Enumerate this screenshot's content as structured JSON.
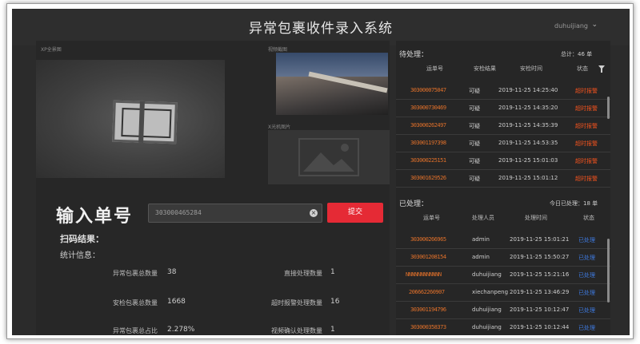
{
  "app": {
    "title": "异常包裹收件录入系统",
    "user": "duhuijiang"
  },
  "camera": {
    "full_label": "XP全景图",
    "video_label": "视频截图",
    "xray_label": "X光机图片"
  },
  "entry": {
    "title": "输入单号",
    "value": "303000465284",
    "submit": "提交"
  },
  "scan": {
    "label": "扫码结果："
  },
  "stats": {
    "label": "统计信息：",
    "left": [
      {
        "name": "异常包裹总数量",
        "value": "38"
      },
      {
        "name": "安检包裹总数量",
        "value": "1668"
      },
      {
        "name": "异常包裹总占比",
        "value": "2.278%"
      }
    ],
    "right": [
      {
        "name": "直接处理数量",
        "value": "1"
      },
      {
        "name": "超时报警处理数量",
        "value": "16"
      },
      {
        "name": "视频确认处理数量",
        "value": "1"
      }
    ]
  },
  "pending": {
    "title": "待处理：",
    "total": "总计：46 单",
    "headers": [
      "运单号",
      "安检结果",
      "安检时间",
      "状态"
    ],
    "rows": [
      {
        "id": "303000075047",
        "result": "可疑",
        "time": "2019-11-25 14:25:40",
        "status": "超时报警"
      },
      {
        "id": "303000730469",
        "result": "可疑",
        "time": "2019-11-25 14:35:20",
        "status": "超时报警"
      },
      {
        "id": "303000262497",
        "result": "可疑",
        "time": "2019-11-25 14:35:39",
        "status": "超时报警"
      },
      {
        "id": "303001197398",
        "result": "可疑",
        "time": "2019-11-25 14:53:35",
        "status": "超时报警"
      },
      {
        "id": "303000225151",
        "result": "可疑",
        "time": "2019-11-25 15:01:03",
        "status": "超时报警"
      },
      {
        "id": "303001629526",
        "result": "可疑",
        "time": "2019-11-25 15:01:12",
        "status": "超时报警"
      }
    ]
  },
  "processed": {
    "title": "已处理：",
    "total": "今日已处理：18 单",
    "headers": [
      "运单号",
      "处理人员",
      "处理时间",
      "状态"
    ],
    "rows": [
      {
        "id": "303000266965",
        "handler": "admin",
        "time": "2019-11-25 15:01:21",
        "status": "已处理"
      },
      {
        "id": "303001208154",
        "handler": "admin",
        "time": "2019-11-25 15:50:27",
        "status": "已处理"
      },
      {
        "id": "NNNNNNNNNNNN",
        "handler": "duhuijiang",
        "time": "2019-11-25 15:21:16",
        "status": "已处理"
      },
      {
        "id": "206662260907",
        "handler": "xiechanpeng",
        "time": "2019-11-25 13:46:29",
        "status": "已处理"
      },
      {
        "id": "303001194796",
        "handler": "duhuijiang",
        "time": "2019-11-25 10:12:47",
        "status": "已处理"
      },
      {
        "id": "303000358373",
        "handler": "duhuijiang",
        "time": "2019-11-25 10:12:44",
        "status": "已处理"
      }
    ]
  }
}
